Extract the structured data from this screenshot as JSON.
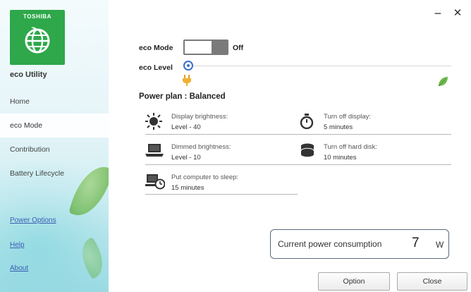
{
  "window": {
    "minimize_glyph": "−",
    "close_glyph": "✕"
  },
  "sidebar": {
    "brand": "TOSHIBA",
    "app_name": "eco Utility",
    "items": [
      {
        "label": "Home"
      },
      {
        "label": "eco Mode"
      },
      {
        "label": "Contribution"
      },
      {
        "label": "Battery Lifecycle"
      }
    ],
    "links": [
      {
        "label": "Power Options"
      },
      {
        "label": "Help"
      },
      {
        "label": "About"
      }
    ]
  },
  "eco": {
    "mode_label": "eco Mode",
    "mode_state": "Off",
    "level_label": "eco Level"
  },
  "power_plan": {
    "heading": "Power plan : Balanced",
    "settings": [
      {
        "title": "Display brightness:",
        "value": "Level - 40",
        "icon": "sun-icon"
      },
      {
        "title": "Turn off display:",
        "value": "5 minutes",
        "icon": "timer-icon"
      },
      {
        "title": "Dimmed brightness:",
        "value": "Level - 10",
        "icon": "laptop-icon"
      },
      {
        "title": "Turn off hard disk:",
        "value": "10 minutes",
        "icon": "hard-disk-icon"
      },
      {
        "title": "Put computer to sleep:",
        "value": "15 minutes",
        "icon": "sleep-clock-icon"
      }
    ]
  },
  "consumption": {
    "label": "Current power consumption",
    "value": "7",
    "unit": "W"
  },
  "buttons": {
    "option": "Option",
    "close": "Close"
  },
  "colors": {
    "brand_green": "#2ea84a",
    "accent_blue": "#3b6fc4",
    "leaf_green": "#6fb84d"
  }
}
